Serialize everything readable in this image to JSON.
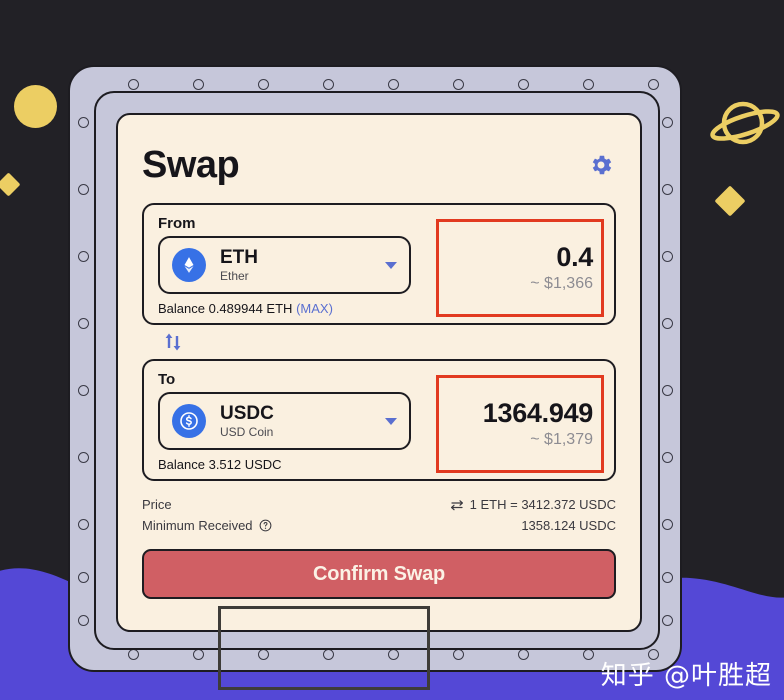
{
  "app": {
    "title": "Swap",
    "settings_icon": "gear-icon"
  },
  "from_panel": {
    "label": "From",
    "token_symbol": "ETH",
    "token_name": "Ether",
    "token_icon": "ethereum-icon",
    "balance_text": "Balance 0.489944 ETH",
    "max_label": "(MAX)",
    "amount": "0.4",
    "amount_usd": "~ $1,366",
    "highlight_color": "#e23a20"
  },
  "switch_icon": "swap-direction-icon",
  "to_panel": {
    "label": "To",
    "token_symbol": "USDC",
    "token_name": "USD Coin",
    "token_icon": "usdc-icon",
    "balance_text": "Balance 3.512 USDC",
    "amount": "1364.949",
    "amount_usd": "~ $1,379",
    "highlight_color": "#e23a20"
  },
  "info": {
    "price_label": "Price",
    "price_value": "1 ETH = 3412.372 USDC",
    "price_swap_icon": "exchange-arrows-icon",
    "minimum_label": "Minimum Received",
    "minimum_info_icon": "info-circle-icon",
    "minimum_value": "1358.124 USDC"
  },
  "confirm": {
    "label": "Confirm Swap",
    "button_color": "#d05f64",
    "annotation_color": "#3e3c38"
  },
  "watermark": {
    "text": "知乎 @叶胜超"
  },
  "decor": {
    "yellow": "#ecce63",
    "purple": "#5448d6",
    "dark": "#222126",
    "frame": "#c6c7da",
    "card": "#faf0e0"
  }
}
